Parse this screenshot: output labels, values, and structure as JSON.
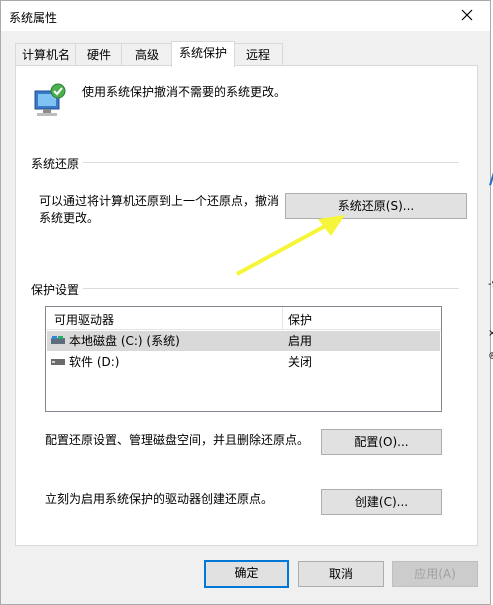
{
  "window": {
    "title": "系统属性"
  },
  "tabs": [
    {
      "label": "计算机名"
    },
    {
      "label": "硬件"
    },
    {
      "label": "高级"
    },
    {
      "label": "系统保护"
    },
    {
      "label": "远程"
    }
  ],
  "intro": {
    "text": "使用系统保护撤消不需要的系统更改。"
  },
  "restore": {
    "group_label": "系统还原",
    "description": "可以通过将计算机还原到上一个还原点，撤消系统更改。",
    "button_label": "系统还原(S)..."
  },
  "protection": {
    "group_label": "保护设置",
    "columns": [
      "可用驱动器",
      "保护"
    ],
    "drives": [
      {
        "name": "本地磁盘 (C:) (系统)",
        "protection": "启用"
      },
      {
        "name": "软件 (D:)",
        "protection": "关闭"
      }
    ],
    "configure_text": "配置还原设置、管理磁盘空间，并且删除还原点。",
    "configure_button": "配置(O)...",
    "create_text": "立刻为启用系统保护的驱动器创建还原点。",
    "create_button": "创建(C)..."
  },
  "footer": {
    "ok": "确定",
    "cancel": "取消",
    "apply": "应用(A)"
  },
  "edge_glyphs": [
    "/",
    "-9",
    "×",
    "®"
  ],
  "colors": {
    "accent": "#0078d7",
    "arrow": "#f5f53a"
  }
}
